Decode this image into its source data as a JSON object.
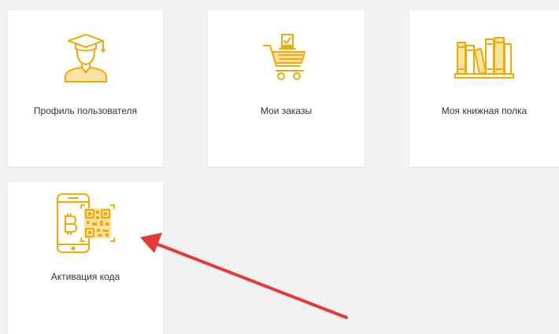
{
  "colors": {
    "icon": "#f5a800",
    "icon_dark": "#e39a00",
    "arrow": "#e53935",
    "card_bg": "#ffffff",
    "page_bg": "#f2f2f2",
    "text": "#333333"
  },
  "cards": [
    {
      "label": "Профиль пользователя",
      "icon": "graduate-icon"
    },
    {
      "label": "Мои заказы",
      "icon": "shopping-cart-icon"
    },
    {
      "label": "Моя книжная полка",
      "icon": "bookshelf-icon"
    },
    {
      "label": "Активация кода",
      "icon": "phone-qr-code-icon"
    }
  ]
}
